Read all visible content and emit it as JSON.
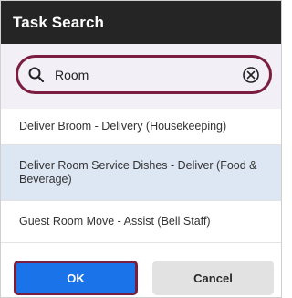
{
  "dialog": {
    "title": "Task Search"
  },
  "search": {
    "value": "Room",
    "search_icon": "search-icon",
    "clear_icon": "clear-circle-x-icon"
  },
  "results": [
    {
      "label": "Deliver Broom - Delivery (Housekeeping)",
      "selected": false
    },
    {
      "label": "Deliver Room Service Dishes - Deliver (Food & Beverage)",
      "selected": true
    },
    {
      "label": "Guest Room Move - Assist (Bell Staff)",
      "selected": false
    }
  ],
  "buttons": {
    "ok_label": "OK",
    "cancel_label": "Cancel"
  },
  "colors": {
    "titlebar": "#252525",
    "focus_outline": "#7a1d3f",
    "ok_button": "#1a73e8",
    "selected_row": "#dde6f3",
    "cancel_button": "#e2e2e2"
  }
}
